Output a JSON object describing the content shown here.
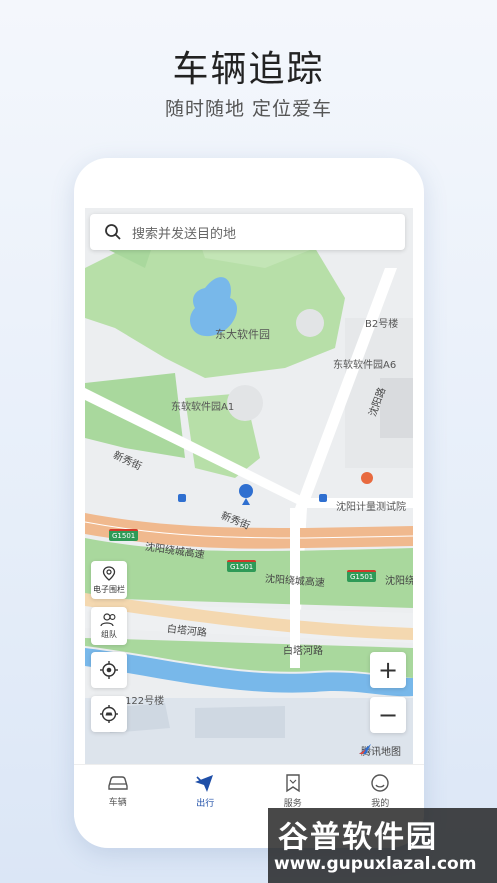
{
  "promo": {
    "title": "车辆追踪",
    "subtitle": "随时随地 定位爱车"
  },
  "search": {
    "placeholder": "搜索并发送目的地"
  },
  "map": {
    "labels": {
      "b2": "B2号楼",
      "dongda": "东大软件园",
      "a6": "东软软件园A6",
      "a1": "东软软件园A1",
      "xinxiu1": "新秀街",
      "xinxiu2": "新秀街",
      "jiliang": "沈阳计量测试院",
      "rao1": "沈阳绕城高速",
      "rao2": "沈阳绕城高速",
      "rao3": "沈阳绕",
      "baita1": "白塔河路",
      "baita2": "白塔河路",
      "lou122": "122号楼",
      "vroad": "沈阳路"
    },
    "shields": [
      "G1501",
      "G1501",
      "G1501"
    ],
    "attribution": "腾讯地图"
  },
  "controls": {
    "fence_label": "电子围栏",
    "team_label": "组队",
    "zoom_in": "+",
    "zoom_out": "−"
  },
  "tabs": [
    {
      "label": "车辆",
      "icon": "car-icon",
      "active": false
    },
    {
      "label": "出行",
      "icon": "travel-icon",
      "active": true
    },
    {
      "label": "服务",
      "icon": "bookmark-icon",
      "active": false
    },
    {
      "label": "我的",
      "icon": "profile-icon",
      "active": false
    }
  ],
  "watermark": {
    "title": "谷普软件园",
    "url": "www.gupuxlazal.com"
  },
  "colors": {
    "accent": "#1f4fa8",
    "park": "#a9d89d",
    "water": "#78b8ea",
    "highway": "#f0b98e"
  }
}
